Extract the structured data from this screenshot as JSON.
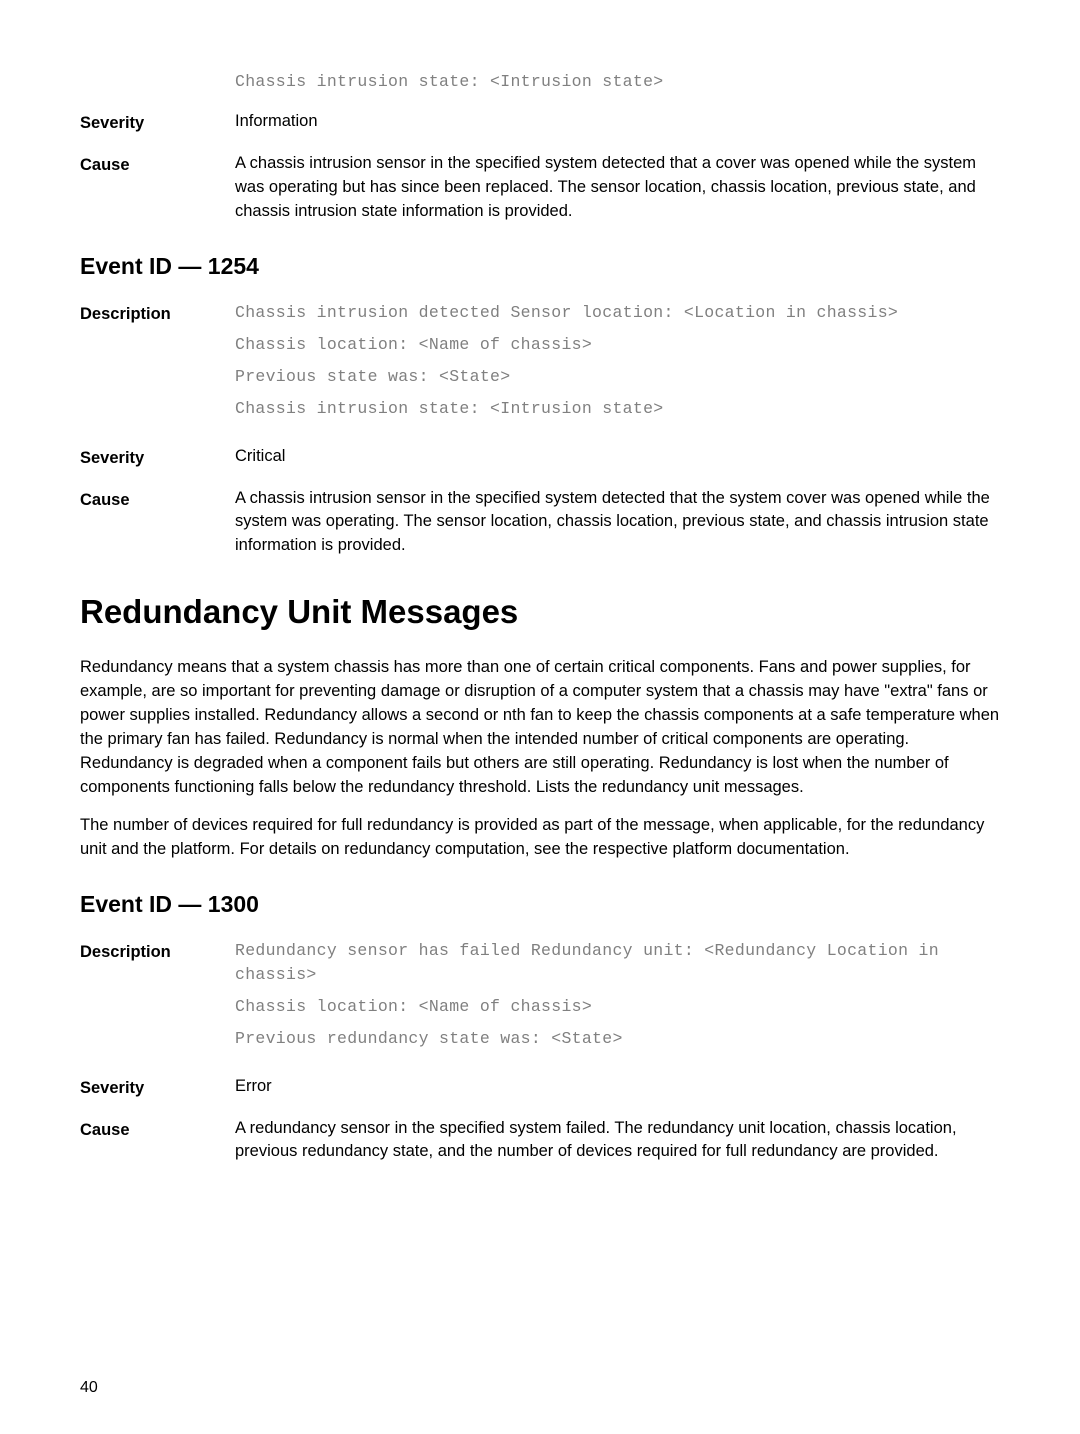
{
  "top_code": "Chassis intrusion state: <Intrusion state>",
  "event_top": {
    "severity_label": "Severity",
    "severity_value": "Information",
    "cause_label": "Cause",
    "cause_value": "A chassis intrusion sensor in the specified system detected that a cover was opened while the system was operating but has since been replaced. The sensor location, chassis location, previous state, and chassis intrusion state information is provided."
  },
  "event_1254": {
    "heading": "Event ID — 1254",
    "description_label": "Description",
    "desc_line1": "Chassis intrusion detected Sensor location: <Location in chassis>",
    "desc_line2": "Chassis location: <Name of chassis>",
    "desc_line3": "Previous state was: <State>",
    "desc_line4": "Chassis intrusion state: <Intrusion state>",
    "severity_label": "Severity",
    "severity_value": "Critical",
    "cause_label": "Cause",
    "cause_value": "A chassis intrusion sensor in the specified system detected that the system cover was opened while the system was operating. The sensor location, chassis location, previous state, and chassis intrusion state information is provided."
  },
  "redundancy": {
    "heading": "Redundancy Unit Messages",
    "para1": "Redundancy means that a system chassis has more than one of certain critical components. Fans and power supplies, for example, are so important for preventing damage or disruption of a computer system that a chassis may have \"extra\" fans or power supplies installed. Redundancy allows a second or nth fan to keep the chassis components at a safe temperature when the primary fan has failed. Redundancy is normal when the intended number of critical components are operating. Redundancy is degraded when a component fails but others are still operating. Redundancy is lost when the number of components functioning falls below the redundancy threshold. Lists the redundancy unit messages.",
    "para2": "The number of devices required for full redundancy is provided as part of the message, when applicable, for the redundancy unit and the platform. For details on redundancy computation, see the respective platform documentation."
  },
  "event_1300": {
    "heading": "Event ID — 1300",
    "description_label": "Description",
    "desc_line1": "Redundancy sensor has failed Redundancy unit: <Redundancy Location in chassis>",
    "desc_line2": "Chassis location: <Name of chassis>",
    "desc_line3": "Previous redundancy state was: <State>",
    "severity_label": "Severity",
    "severity_value": "Error",
    "cause_label": "Cause",
    "cause_value": "A redundancy sensor in the specified system failed. The redundancy unit location, chassis location, previous redundancy state, and the number of devices required for full redundancy are provided."
  },
  "page_number": "40"
}
